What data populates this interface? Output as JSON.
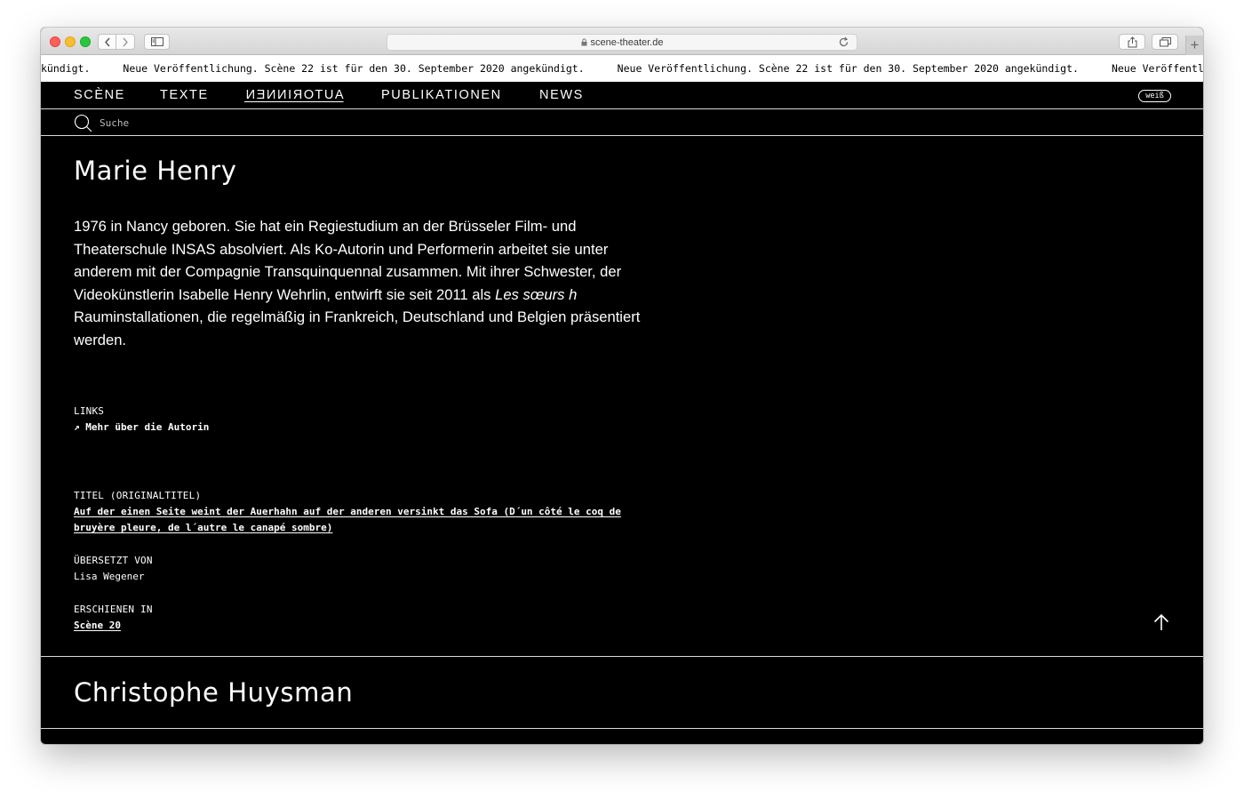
{
  "browser": {
    "url": "scene-theater.de",
    "new_tab_label": "+"
  },
  "ticker": {
    "items": [
      "kündigt.",
      "Neue Veröffentlichung. Scène 22 ist für den 30. September 2020 angekündigt.",
      "Neue Veröffentlichung. Scène 22 ist für den 30. September 2020 angekündigt.",
      "Neue Veröffentl"
    ]
  },
  "nav": {
    "items": [
      "SCÈNE",
      "TEXTE",
      "AUTORINNEN",
      "PUBLIKATIONEN",
      "NEWS"
    ],
    "mode_toggle": "weiß"
  },
  "search": {
    "placeholder": "Suche"
  },
  "authors": [
    {
      "name": "Marie Henry",
      "bio_before": "1976 in Nancy geboren. Sie hat ein Regiestudium an der Brüsseler Film- und Theaterschule INSAS absolviert. Als Ko-Autorin und Performerin arbeitet sie unter anderem mit der Compagnie Transquinquennal zusammen. Mit ihrer Schwester, der Videokünstlerin Isabelle Henry Wehrlin, entwirft sie seit 2011 als ",
      "bio_italic": "Les sœurs h",
      "bio_after": " Rauminstallationen, die regelmäßig in Frankreich, Deutschland und Belgien präsentiert werden.",
      "links_label": "LINKS",
      "link_text": "↗ Mehr über die Autorin",
      "title_label": "TITEL (ORIGINALTITEL)",
      "title_value": "Auf der einen Seite weint der Auerhahn auf der anderen versinkt das Sofa (D´un côté le coq de bruyère pleure, de l´autre le canapé sombre)",
      "translated_label": "ÜBERSETZT VON",
      "translator": "Lisa Wegener",
      "published_label": "ERSCHIENEN IN",
      "published_value": "Scène 20"
    },
    {
      "name": "Christophe Huysman"
    }
  ]
}
